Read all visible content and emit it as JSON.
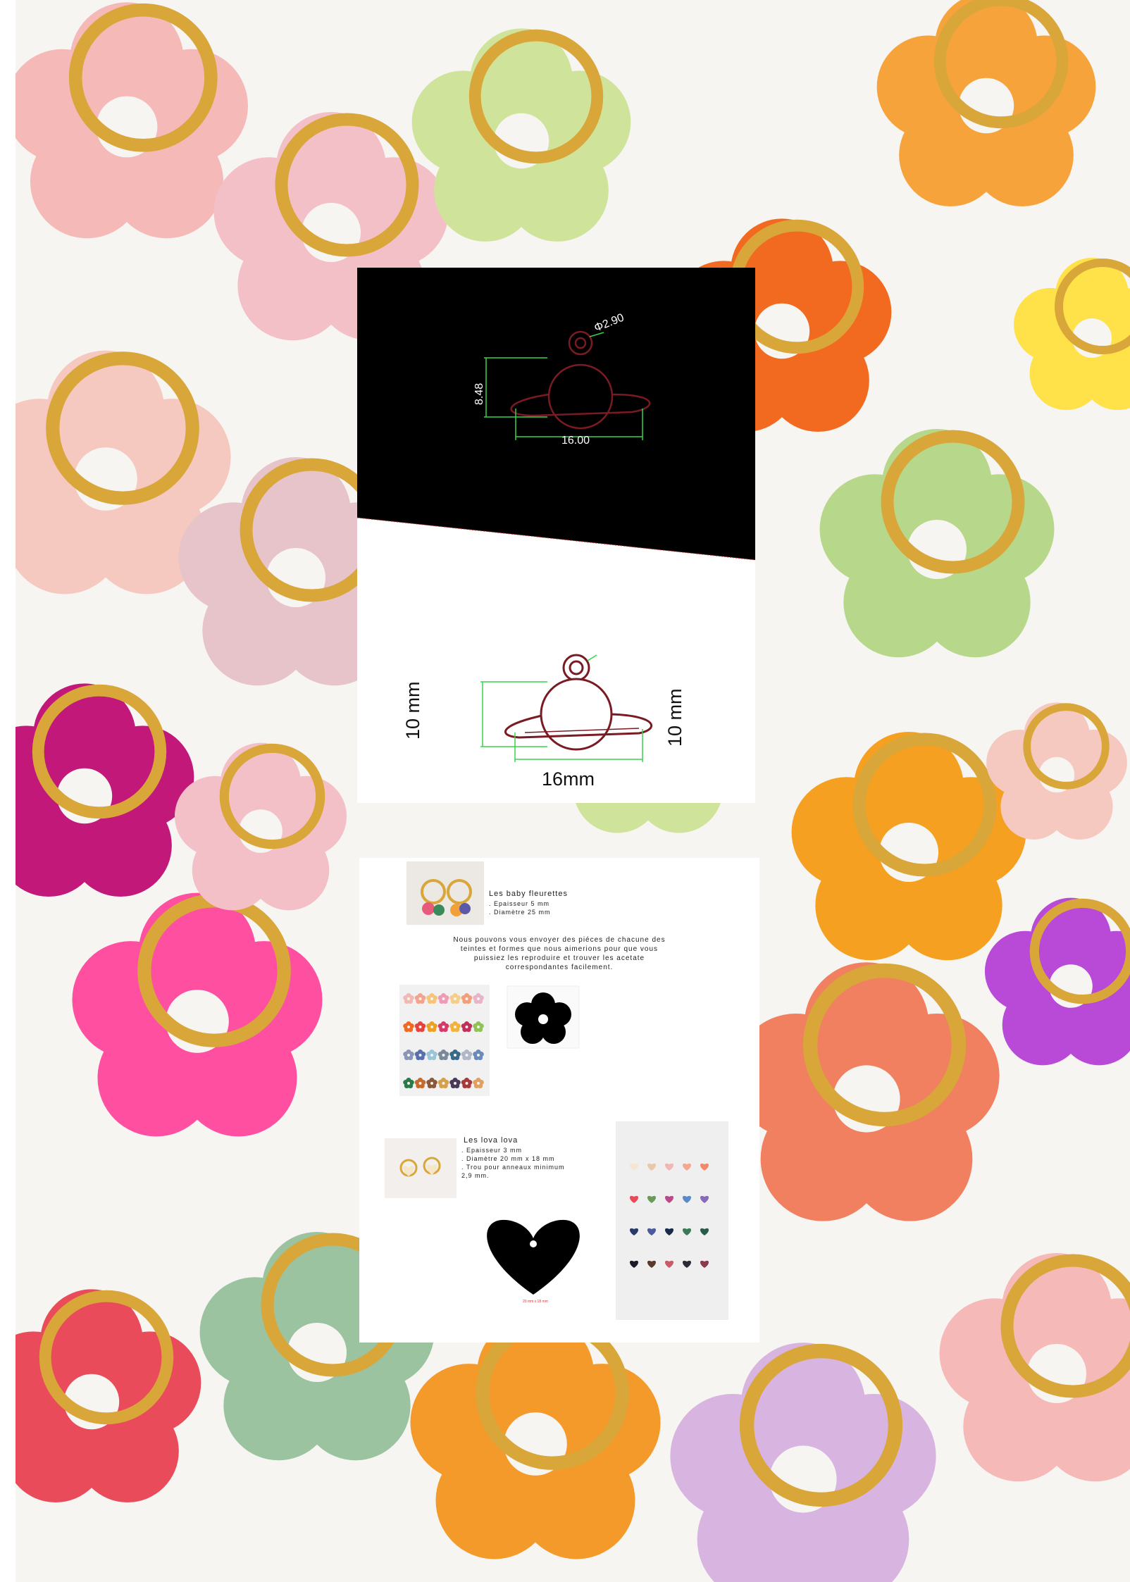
{
  "diagram": {
    "dim_hole": "Φ2.90",
    "dim_height": "8.48",
    "dim_width": "16.00",
    "dim_left_mm": "10 mm",
    "dim_right_mm": "10 mm",
    "dim_width_mm": "16mm"
  },
  "spec": {
    "baby": {
      "title": "Les baby fleurettes",
      "lines": [
        ". Epaisseur 5 mm",
        ". Diamètre 25 mm"
      ]
    },
    "intro": [
      "Nous pouvons vous envoyer des piéces de chacune des",
      "teintes et formes que nous aimerions pour que vous",
      "puissiez les reproduire et trouver les acetate",
      "correspondantes facilement."
    ],
    "lova": {
      "title": "Les lova lova",
      "lines": [
        ". Epaisseur 3 mm",
        ". Diamètre 20 mm x 18 mm",
        ". Trou pour anneaux minimum",
        "2,9 mm."
      ]
    },
    "heart_caption": "20 mm x 18 mm"
  },
  "colors": {
    "diagram_bg": "#000000",
    "outline": "#7a1a22",
    "dimension": "#39d34a",
    "heart": "#000000",
    "gold": "#d9a63a"
  },
  "swatches": {
    "flowers": [
      [
        "#f2b8b4",
        "#f4a48c",
        "#f7c47a",
        "#f09bb6",
        "#f5cf8a",
        "#f39e7a",
        "#e9b3c8"
      ],
      [
        "#f26a1f",
        "#e8423c",
        "#f0a020",
        "#d63a6a",
        "#f5b23a",
        "#c2305a",
        "#8fc455"
      ],
      [
        "#8a95b8",
        "#5a6fb0",
        "#9ac4d8",
        "#7a8a9a",
        "#3a6a8a",
        "#b0b8c8",
        "#6a8ab8"
      ],
      [
        "#2a7a4a",
        "#c86a2a",
        "#8a5a3a",
        "#d4a04a",
        "#4a3a5a",
        "#a83a3a",
        "#e0a060"
      ]
    ],
    "hearts": [
      [
        "#f4e6d0",
        "#e8c8a8",
        "#f0b8b0",
        "#f5a890",
        "#f28a6a"
      ],
      [
        "#e84a5a",
        "#6a9a5a",
        "#b84a8a",
        "#5a8ac8",
        "#8a6ab8"
      ],
      [
        "#2a3a6a",
        "#4a5a9a",
        "#1a2a4a",
        "#3a7a5a",
        "#2a5a4a"
      ],
      [
        "#1a1a2a",
        "#5a3a2a",
        "#c85a6a",
        "#2a2a3a",
        "#8a3a4a"
      ]
    ]
  }
}
